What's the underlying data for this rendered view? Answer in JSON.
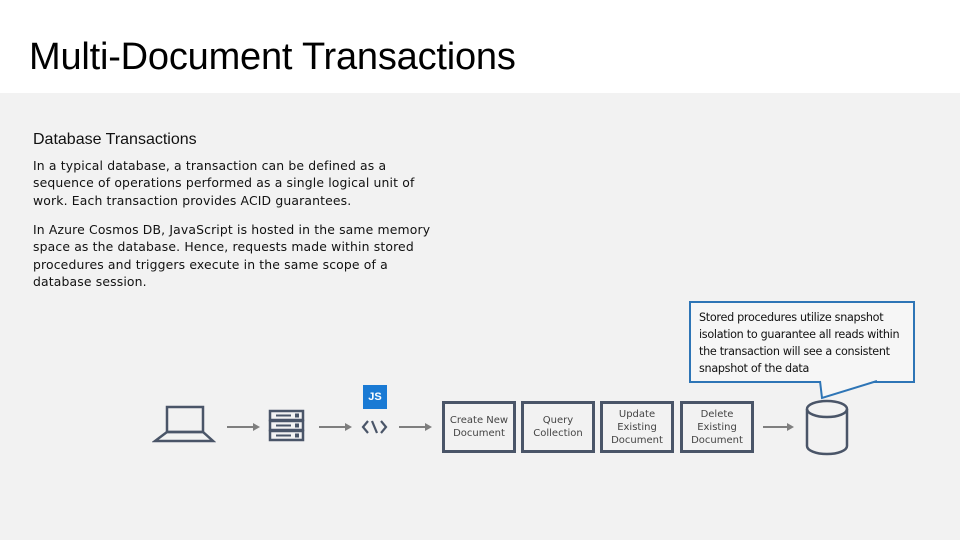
{
  "slide": {
    "title": "Multi-Document Transactions",
    "heading": "Database Transactions",
    "paragraphs": [
      "In a typical database, a transaction can be defined as a sequence of operations performed as a single logical unit of work. Each transaction provides ACID guarantees.",
      "In Azure Cosmos DB, JavaScript is hosted in the same memory space as the database. Hence, requests made within stored procedures and triggers execute in the same scope of a database session."
    ],
    "callout": "Stored procedures utilize snapshot isolation to guarantee all reads within the transaction will see a consistent snapshot of the data"
  },
  "diagram": {
    "icons": {
      "client": "laptop-icon",
      "server": "server-icon",
      "code": "code-icon",
      "database": "database-cylinder-icon"
    },
    "js_badge": "JS",
    "steps": [
      "Create New Document",
      "Query Collection",
      "Update Existing Document",
      "Delete Existing Document"
    ]
  },
  "colors": {
    "callout_border": "#2e75b6",
    "js_badge": "#1a7ad4",
    "icon_stroke": "#4a5568",
    "arrow": "#7f7f7f"
  }
}
